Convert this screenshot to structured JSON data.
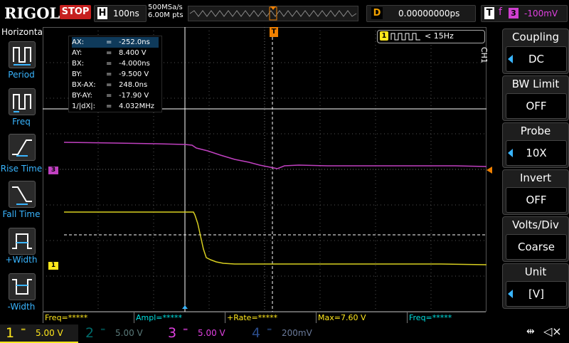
{
  "top": {
    "brand": "RIGOL",
    "run_state": "STOP",
    "timebase_label": "H",
    "timebase_value": "100ns",
    "sample_rate": "500MSa/s",
    "memory_depth": "6.00M pts",
    "delay_label": "D",
    "delay_value": "0.00000000ps",
    "trigger_label": "T",
    "trigger_edge": "f",
    "trigger_source": "3",
    "trigger_level": "-100mV"
  },
  "left_menu": {
    "title": "Horizontal",
    "items": [
      {
        "label": "Period",
        "icon": "period-icon"
      },
      {
        "label": "Freq",
        "icon": "freq-icon"
      },
      {
        "label": "Rise Time",
        "icon": "rise-time-icon"
      },
      {
        "label": "Fall Time",
        "icon": "fall-time-icon"
      },
      {
        "label": "+Width",
        "icon": "plus-width-icon"
      },
      {
        "label": "-Width",
        "icon": "minus-width-icon"
      }
    ]
  },
  "cursor_readout": [
    {
      "key": "AX:",
      "value": "-252.0ns"
    },
    {
      "key": "AY:",
      "value": "8.400 V"
    },
    {
      "key": "BX:",
      "value": "-4.000ns"
    },
    {
      "key": "BY:",
      "value": "-9.500 V"
    },
    {
      "key": "BX-AX:",
      "value": "248.0ns"
    },
    {
      "key": "BY-AY:",
      "value": "-17.90 V"
    },
    {
      "key": "1/|dX|:",
      "value": "4.032MHz"
    }
  ],
  "cursor_eq": "=",
  "freq_counter": {
    "channel": "1",
    "text": "< 15Hz"
  },
  "markers": {
    "ch3": "3",
    "ch1": "1",
    "trigger": "T"
  },
  "channel_menu": {
    "tab": "CH1",
    "items": [
      {
        "title": "Coupling",
        "value": "DC"
      },
      {
        "title": "BW Limit",
        "value": "OFF"
      },
      {
        "title": "Probe",
        "value": "10X"
      },
      {
        "title": "Invert",
        "value": "OFF"
      },
      {
        "title": "Volts/Div",
        "value": "Coarse"
      },
      {
        "title": "Unit",
        "value": "[V]"
      }
    ]
  },
  "measurements": [
    {
      "text": "Freq=*****",
      "color": "#ffe71c"
    },
    {
      "text": "Ampl=*****",
      "color": "#00e0e0"
    },
    {
      "text": "+Rate=*****",
      "color": "#ffe71c"
    },
    {
      "text": "Max=7.60 V",
      "color": "#ffe71c"
    },
    {
      "text": "Freq=*****",
      "color": "#00e0e0"
    }
  ],
  "channels": [
    {
      "num": "1",
      "scale": "5.00 V",
      "color": "#ffe71c",
      "active": true
    },
    {
      "num": "2",
      "scale": "5.00 V",
      "color": "#00a0a0",
      "active": false
    },
    {
      "num": "3",
      "scale": "5.00 V",
      "color": "#e040e0",
      "active": true
    },
    {
      "num": "4",
      "scale": "200mV",
      "color": "#3a6cd0",
      "active": false
    }
  ],
  "colors": {
    "ch1": "#ffe71c",
    "ch2": "#00a0a0",
    "ch3": "#c040c0",
    "ch4": "#3a6cd0",
    "trigger": "#f08000",
    "accent": "#39b5ff"
  }
}
